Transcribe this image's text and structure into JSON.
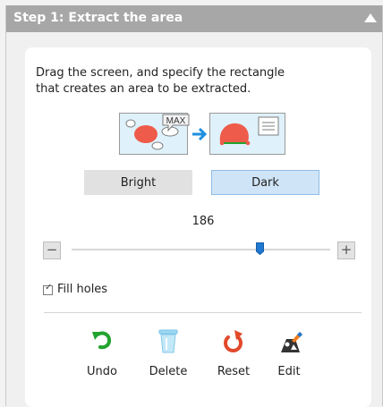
{
  "panel": {
    "title": "Step 1: Extract the area",
    "instruction_line1": "Drag the screen, and specify the rectangle",
    "instruction_line2": "that creates an area to be extracted.",
    "illustration_badge": "MAX"
  },
  "mode_buttons": {
    "bright_label": "Bright",
    "dark_label": "Dark",
    "selected": "Dark"
  },
  "threshold": {
    "value": "186",
    "min_label": "−",
    "max_label": "+",
    "fraction": 0.73
  },
  "options": {
    "fill_holes_label": "Fill holes",
    "fill_holes_checked": true
  },
  "actions": {
    "undo_label": "Undo",
    "delete_label": "Delete",
    "reset_label": "Reset",
    "edit_label": "Edit"
  },
  "colors": {
    "header_bg": "#a7a7a7",
    "accent_blue": "#1f78d1",
    "undo_green": "#22a32f",
    "reset_red": "#e2492b"
  }
}
